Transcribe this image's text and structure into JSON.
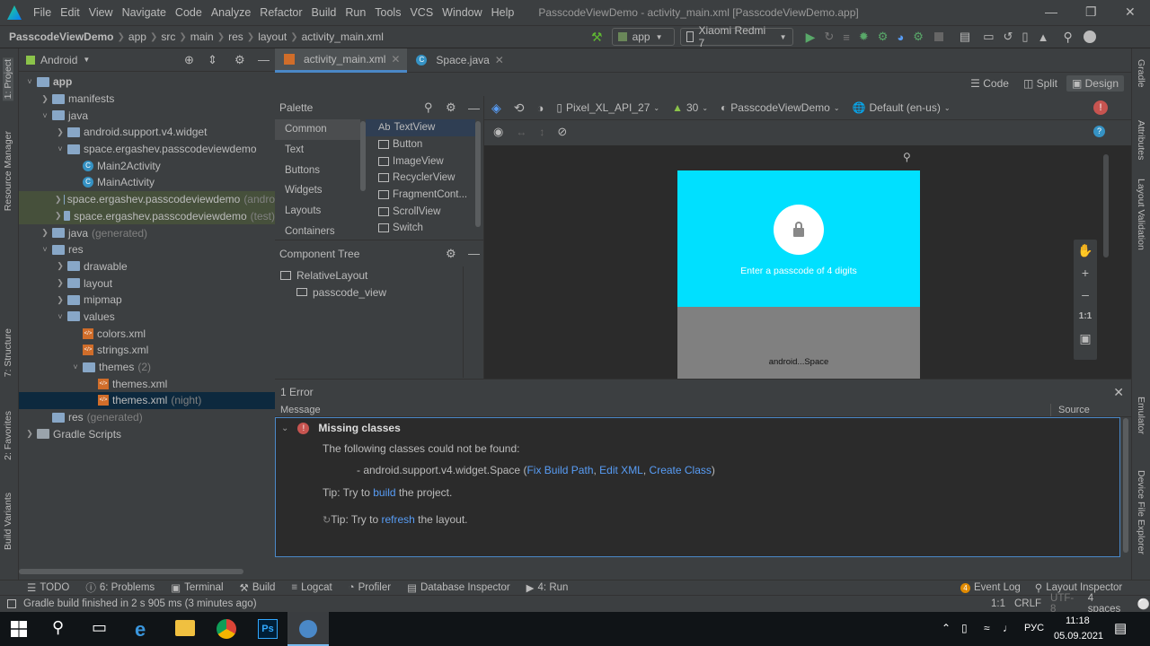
{
  "menu": {
    "items": [
      "File",
      "Edit",
      "View",
      "Navigate",
      "Code",
      "Analyze",
      "Refactor",
      "Build",
      "Run",
      "Tools",
      "VCS",
      "Window",
      "Help"
    ],
    "title": "PasscodeViewDemo - activity_main.xml [PasscodeViewDemo.app]"
  },
  "breadcrumb": [
    "PasscodeViewDemo",
    "app",
    "src",
    "main",
    "res",
    "layout",
    "activity_main.xml"
  ],
  "toolbar": {
    "config": "app",
    "device": "Xiaomi Redmi 7"
  },
  "left_tabs": {
    "project": "1: Project",
    "resource_manager": "Resource Manager",
    "structure": "7: Structure",
    "favorites": "2: Favorites",
    "build_variants": "Build Variants"
  },
  "right_tabs": {
    "gradle": "Gradle",
    "attributes": "Attributes",
    "layout_validation": "Layout Validation",
    "emulator": "Emulator",
    "device_explorer": "Device File Explorer"
  },
  "project": {
    "view": "Android",
    "tree": [
      {
        "label": "app",
        "extra": "",
        "depth": 0,
        "arrow": "open",
        "icon": "folder",
        "bold": true
      },
      {
        "label": "manifests",
        "extra": "",
        "depth": 1,
        "arrow": "closed",
        "icon": "folder"
      },
      {
        "label": "java",
        "extra": "",
        "depth": 1,
        "arrow": "open",
        "icon": "folder"
      },
      {
        "label": "android.support.v4.widget",
        "extra": "",
        "depth": 2,
        "arrow": "closed",
        "icon": "folder"
      },
      {
        "label": "space.ergashev.passcodeviewdemo",
        "extra": "",
        "depth": 2,
        "arrow": "open",
        "icon": "folder"
      },
      {
        "label": "Main2Activity",
        "extra": "",
        "depth": 3,
        "arrow": "",
        "icon": "class"
      },
      {
        "label": "MainActivity",
        "extra": "",
        "depth": 3,
        "arrow": "",
        "icon": "class"
      },
      {
        "label": "space.ergashev.passcodeviewdemo",
        "extra": "(andro",
        "depth": 2,
        "arrow": "closed",
        "icon": "folder",
        "hl": true
      },
      {
        "label": "space.ergashev.passcodeviewdemo",
        "extra": "(test)",
        "depth": 2,
        "arrow": "closed",
        "icon": "folder",
        "hl": true
      },
      {
        "label": "java",
        "extra": "(generated)",
        "depth": 1,
        "arrow": "closed",
        "icon": "folder"
      },
      {
        "label": "res",
        "extra": "",
        "depth": 1,
        "arrow": "open",
        "icon": "folder"
      },
      {
        "label": "drawable",
        "extra": "",
        "depth": 2,
        "arrow": "closed",
        "icon": "folder"
      },
      {
        "label": "layout",
        "extra": "",
        "depth": 2,
        "arrow": "closed",
        "icon": "folder"
      },
      {
        "label": "mipmap",
        "extra": "",
        "depth": 2,
        "arrow": "closed",
        "icon": "folder"
      },
      {
        "label": "values",
        "extra": "",
        "depth": 2,
        "arrow": "open",
        "icon": "folder"
      },
      {
        "label": "colors.xml",
        "extra": "",
        "depth": 3,
        "arrow": "",
        "icon": "xml"
      },
      {
        "label": "strings.xml",
        "extra": "",
        "depth": 3,
        "arrow": "",
        "icon": "xml"
      },
      {
        "label": "themes",
        "extra": "(2)",
        "depth": 3,
        "arrow": "open",
        "icon": "folder"
      },
      {
        "label": "themes.xml",
        "extra": "",
        "depth": 4,
        "arrow": "",
        "icon": "xml"
      },
      {
        "label": "themes.xml",
        "extra": "(night)",
        "depth": 4,
        "arrow": "",
        "icon": "xml",
        "sel": true
      },
      {
        "label": "res",
        "extra": "(generated)",
        "depth": 1,
        "arrow": "",
        "icon": "folder"
      },
      {
        "label": "Gradle Scripts",
        "extra": "",
        "depth": 0,
        "arrow": "closed",
        "icon": "gradle"
      }
    ]
  },
  "editor": {
    "tabs": [
      "activity_main.xml",
      "Space.java"
    ],
    "modes": [
      "Code",
      "Split",
      "Design"
    ]
  },
  "palette": {
    "title": "Palette",
    "categories": [
      "Common",
      "Text",
      "Buttons",
      "Widgets",
      "Layouts",
      "Containers"
    ],
    "items": [
      {
        "icon": "Ab",
        "label": "TextView"
      },
      {
        "icon": "",
        "label": "Button"
      },
      {
        "icon": "",
        "label": "ImageView"
      },
      {
        "icon": "",
        "label": "RecyclerView"
      },
      {
        "icon": "",
        "label": "FragmentCont..."
      },
      {
        "icon": "",
        "label": "ScrollView"
      },
      {
        "icon": "",
        "label": "Switch"
      }
    ]
  },
  "component_tree": {
    "title": "Component Tree",
    "nodes": [
      "RelativeLayout",
      "passcode_view"
    ]
  },
  "design_toolbar": {
    "device": "Pixel_XL_API_27",
    "api": "30",
    "theme": "PasscodeViewDemo",
    "locale": "Default (en-us)"
  },
  "preview": {
    "prompt": "Enter a passcode of 4 digits",
    "space_label": "android...Space",
    "zoom_ratio": "1:1",
    "colors": {
      "header": "#00e0ff",
      "body": "#808080"
    }
  },
  "problems": {
    "count": "1 Error",
    "col_message": "Message",
    "col_source": "Source",
    "heading": "Missing classes",
    "line1": "The following classes could not be found:",
    "class_item": "- android.support.v4.widget.Space (",
    "fix_build_path": "Fix Build Path",
    "edit_xml": "Edit XML",
    "create_class": "Create Class",
    "tip1_a": "Tip: Try to ",
    "tip1_link": "build",
    "tip1_b": " the project.",
    "tip2_a": "Tip: Try to ",
    "tip2_link": "refresh",
    "tip2_b": " the layout."
  },
  "bottom_tabs": [
    "TODO",
    "6: Problems",
    "Terminal",
    "Build",
    "Logcat",
    "Profiler",
    "Database Inspector",
    "4: Run"
  ],
  "bottom_right_tabs": {
    "event_log": "Event Log",
    "event_count": "4",
    "layout_inspector": "Layout Inspector"
  },
  "status": {
    "message": "Gradle build finished in 2 s 905 ms (3 minutes ago)",
    "pos": "1:1",
    "eol": "CRLF",
    "encoding": "UTF-8",
    "indent": "4 spaces"
  },
  "taskbar": {
    "lang": "РУС",
    "time": "11:18",
    "date": "05.09.2021"
  }
}
